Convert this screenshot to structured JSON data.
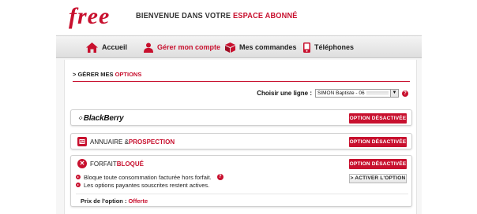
{
  "header": {
    "logo": "free",
    "welcome_prefix": "BIENVENUE DANS VOTRE",
    "welcome_accent": "ESPACE ABONNÉ"
  },
  "nav": {
    "items": [
      {
        "label": "Accueil",
        "icon": "home-icon",
        "active": false
      },
      {
        "label": "Gérer mon compte",
        "icon": "user-icon",
        "active": true
      },
      {
        "label": "Mes commandes",
        "icon": "box-icon",
        "active": false
      },
      {
        "label": "Téléphones",
        "icon": "phone-icon",
        "active": false
      }
    ]
  },
  "section": {
    "prefix": "> GÉRER MES ",
    "accent": "OPTIONS"
  },
  "line_selector": {
    "label": "Choisir une ligne :",
    "selected": "SIMON Baptiste - 06",
    "help": "?"
  },
  "options": [
    {
      "name": "BlackBerry",
      "logo_mark": "⁘",
      "status": "OPTION DÉSACTIVÉE"
    },
    {
      "name_prefix": "ANNUAIRE & ",
      "name_accent": "PROSPECTION",
      "icon": "directory-icon",
      "status": "OPTION DÉSACTIVÉE"
    },
    {
      "name_prefix": "FORFAIT ",
      "name_accent": "BLOQUÉ",
      "icon": "blocked-icon",
      "icon_glyph": "✕",
      "status": "OPTION DÉSACTIVÉE",
      "features": [
        "Bloque toute consommation facturée hors forfait.",
        "Les options payantes souscrites restent actives."
      ],
      "help": "?",
      "activate_label": "> ACTIVER L'OPTION",
      "price_label": "Prix de l'option :",
      "price_value": "Offerte"
    }
  ],
  "colors": {
    "accent": "#c8102e",
    "nav_bg": "#e6e6e6",
    "page_bg": "#f6f6f6"
  }
}
